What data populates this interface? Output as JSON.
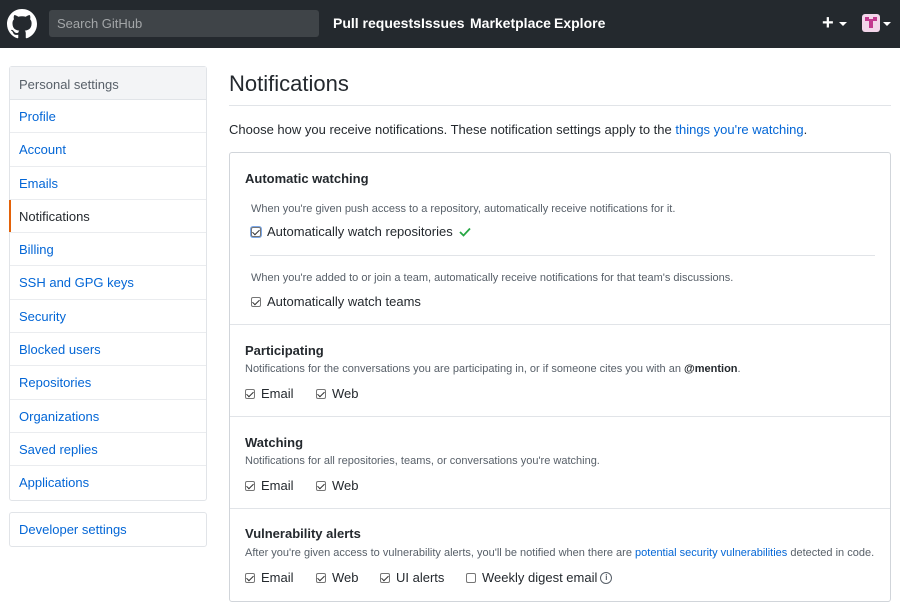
{
  "header": {
    "search_placeholder": "Search GitHub",
    "nav": [
      "Pull requests",
      "Issues",
      "Marketplace",
      "Explore"
    ],
    "plus_label": "+",
    "logo_icon": "github-mark-icon",
    "avatar_icon": "user-avatar-icon"
  },
  "sidebar": {
    "heading": "Personal settings",
    "items": [
      {
        "label": "Profile"
      },
      {
        "label": "Account"
      },
      {
        "label": "Emails"
      },
      {
        "label": "Notifications"
      },
      {
        "label": "Billing"
      },
      {
        "label": "SSH and GPG keys"
      },
      {
        "label": "Security"
      },
      {
        "label": "Blocked users"
      },
      {
        "label": "Repositories"
      },
      {
        "label": "Organizations"
      },
      {
        "label": "Saved replies"
      },
      {
        "label": "Applications"
      }
    ],
    "selected": "Notifications",
    "developer_settings": "Developer settings"
  },
  "main": {
    "title": "Notifications",
    "intro_text": "Choose how you receive notifications. These notification settings apply to the ",
    "intro_link": "things you're watching",
    "intro_end": ".",
    "automatic": {
      "title": "Automatic watching",
      "repo_note": "When you're given push access to a repository, automatically receive notifications for it.",
      "repo_label": "Automatically watch repositories",
      "repo_checked": true,
      "team_note": "When you're added to or join a team, automatically receive notifications for that team's discussions.",
      "team_label": "Automatically watch teams",
      "team_checked": true
    },
    "participating": {
      "title": "Participating",
      "note": "Notifications for the conversations you are participating in, or if someone cites you with an ",
      "note_bold": "@mention",
      "note_end": ".",
      "email_label": "Email",
      "web_label": "Web",
      "email_checked": true,
      "web_checked": true
    },
    "watching": {
      "title": "Watching",
      "note": "Notifications for all repositories, teams, or conversations you're watching.",
      "email_label": "Email",
      "web_label": "Web",
      "email_checked": true,
      "web_checked": true
    },
    "vulnerability": {
      "title": "Vulnerability alerts",
      "note": "After you're given access to vulnerability alerts, you'll be notified when there are ",
      "note_link": "potential security vulnerabilities",
      "note_end": " detected in code.",
      "email_label": "Email",
      "web_label": "Web",
      "ui_label": "UI alerts",
      "digest_label": "Weekly digest email",
      "email_checked": true,
      "web_checked": true,
      "ui_checked": true,
      "digest_checked": false
    }
  },
  "colors": {
    "header_bg": "#24292e",
    "link": "#0366d6",
    "selected_accent": "#e36209",
    "success_check": "#28a745"
  }
}
